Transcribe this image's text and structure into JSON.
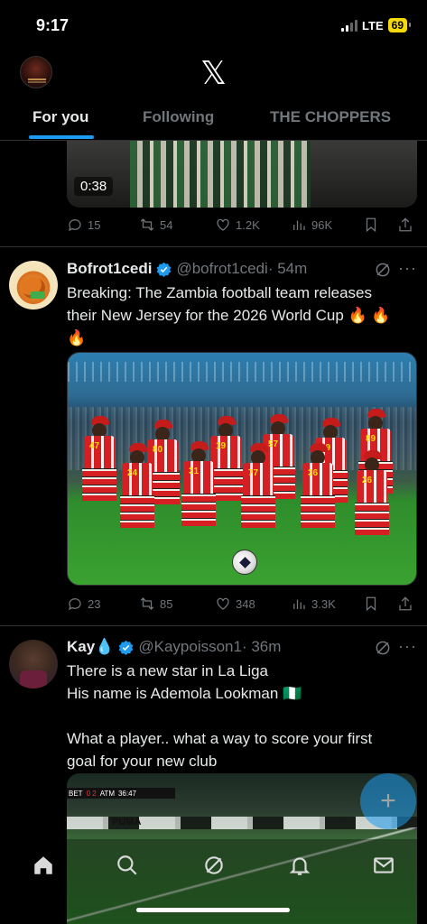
{
  "status_bar": {
    "time": "9:17",
    "network": "LTE",
    "battery": "69"
  },
  "header": {
    "logo": "𝕏",
    "tabs": [
      {
        "label": "For you",
        "active": true
      },
      {
        "label": "Following",
        "active": false
      },
      {
        "label": "THE CHOPPERS",
        "active": false
      }
    ]
  },
  "prev_tweet": {
    "video_duration": "0:38",
    "stats": {
      "replies": "15",
      "reposts": "54",
      "likes": "1.2K",
      "views": "96K"
    }
  },
  "tweets": [
    {
      "name": "Bofrot1cedi",
      "handle": "@bofrot1cedi",
      "time": "· 54m",
      "text_line1": "Breaking: The Zambia football team releases",
      "text_line2": "their New Jersey for the 2026 World Cup 🔥 🔥",
      "text_line3": "🔥",
      "media_numbers": [
        "47",
        "80",
        "19",
        "57",
        "89",
        "99",
        "89",
        "24",
        "31",
        "77",
        "36",
        "26"
      ],
      "stats": {
        "replies": "23",
        "reposts": "85",
        "likes": "348",
        "views": "3.3K"
      }
    },
    {
      "name": "Kay",
      "name_emoji": "💧",
      "handle": "@Kaypoisson1",
      "time": "· 36m",
      "text_line1": "There is a new star in La Liga",
      "text_line2": "His name is Ademola Lookman 🇳🇬",
      "text_line3": "What a player.. what a way to score your first",
      "text_line4": "goal for your new club",
      "media_score": {
        "team1": "BET",
        "score": "0 2",
        "team2": "ATM",
        "clock": "36:47"
      },
      "media_board": "PUMA"
    }
  ],
  "fab": {
    "label": "+"
  },
  "nav": [
    "home-icon",
    "search-icon",
    "grok-icon",
    "notifications-icon",
    "messages-icon"
  ],
  "colors": {
    "accent": "#1d9bf0",
    "background": "#000000",
    "secondary_text": "#71767b"
  }
}
